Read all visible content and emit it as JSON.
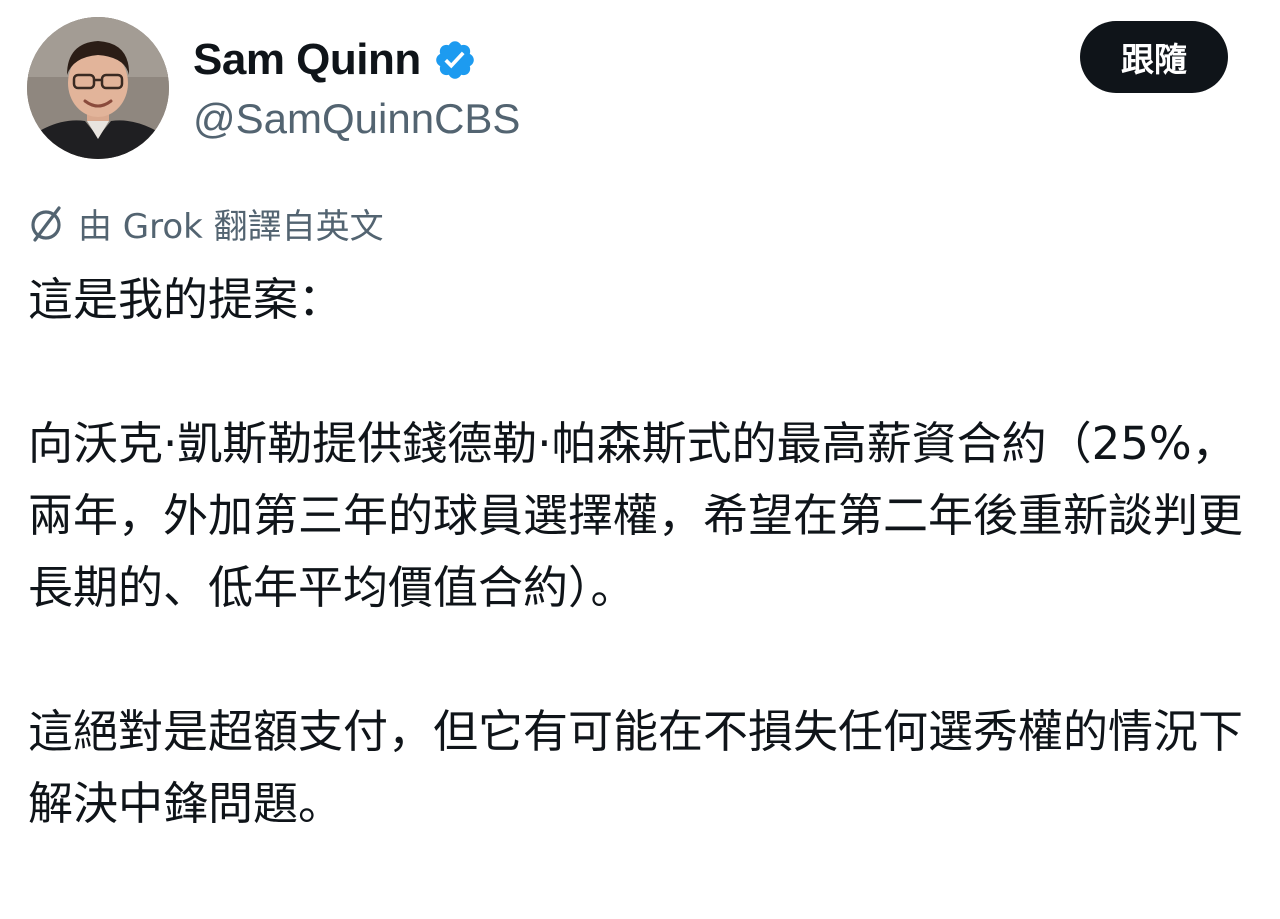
{
  "author": {
    "display_name": "Sam Quinn",
    "handle": "@SamQuinnCBS",
    "verified": true,
    "verified_color": "#1d9bf0",
    "avatar_icon": "user-avatar-photo"
  },
  "actions": {
    "follow_label": "跟隨"
  },
  "translation": {
    "icon": "grok-icon",
    "text": "由 Grok 翻譯自英文"
  },
  "tweet": {
    "paragraphs": [
      "這是我的提案：",
      "向沃克·凱斯勒提供錢德勒·帕森斯式的最高薪資合約（25%，兩年，外加第三年的球員選擇權，希望在第二年後重新談判更長期的、低年平均價值合約）。",
      "這絕對是超額支付，但它有可能在不損失任何選秀權的情況下解決中鋒問題。"
    ]
  },
  "colors": {
    "text_primary": "#0f1419",
    "text_secondary": "#536471",
    "button_bg": "#0f1419",
    "button_text": "#ffffff"
  }
}
